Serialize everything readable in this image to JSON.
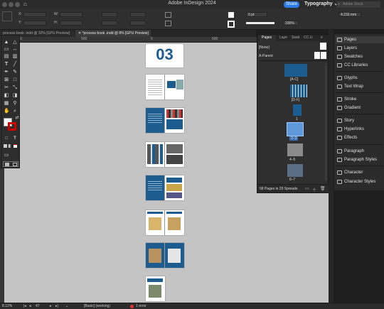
{
  "app": {
    "title": "Adobe InDesign 2024",
    "share_label": "Share",
    "workspace_label": "Typography",
    "search_placeholder": "Adobe Stock"
  },
  "controlbar": {
    "x_label": "X:",
    "y_label": "Y:",
    "w_label": "W:",
    "h_label": "H:",
    "stroke_weight": "0 pt",
    "zoom_percent": "100%",
    "width_value": "4.233 mm"
  },
  "tabs": [
    {
      "label": "process book .indd @ 32% [GPU Preview]"
    },
    {
      "label": "*process book .indd @ 8% [GPU Preview]"
    }
  ],
  "ruler": {
    "marks": [
      "0",
      "500",
      "0",
      "500"
    ]
  },
  "spreads": {
    "cover_text": "03"
  },
  "pages_panel": {
    "tabs": [
      "Pages",
      "Laye",
      "Swat",
      "CC Li"
    ],
    "none_label": "[None]",
    "a_parent_label": "A-Parent",
    "thumb_labels": [
      "[A-C]",
      "[D-F]",
      "1",
      "2–3",
      "4–5",
      "6–7"
    ],
    "footer_text": "58 Pages in 29 Spreads"
  },
  "right_panels": {
    "items": [
      "Pages",
      "Layers",
      "Swatches",
      "CC Libraries",
      "Glyphs",
      "Text Wrap",
      "Stroke",
      "Gradient",
      "Story",
      "Hyperlinks",
      "Effects",
      "Paragraph",
      "Paragraph Styles",
      "Character",
      "Character Styles"
    ]
  },
  "statusbar": {
    "zoom": "8.12%",
    "page_number": "47",
    "preflight_profile": "[Basic] (working)",
    "error_text": "1 error"
  }
}
